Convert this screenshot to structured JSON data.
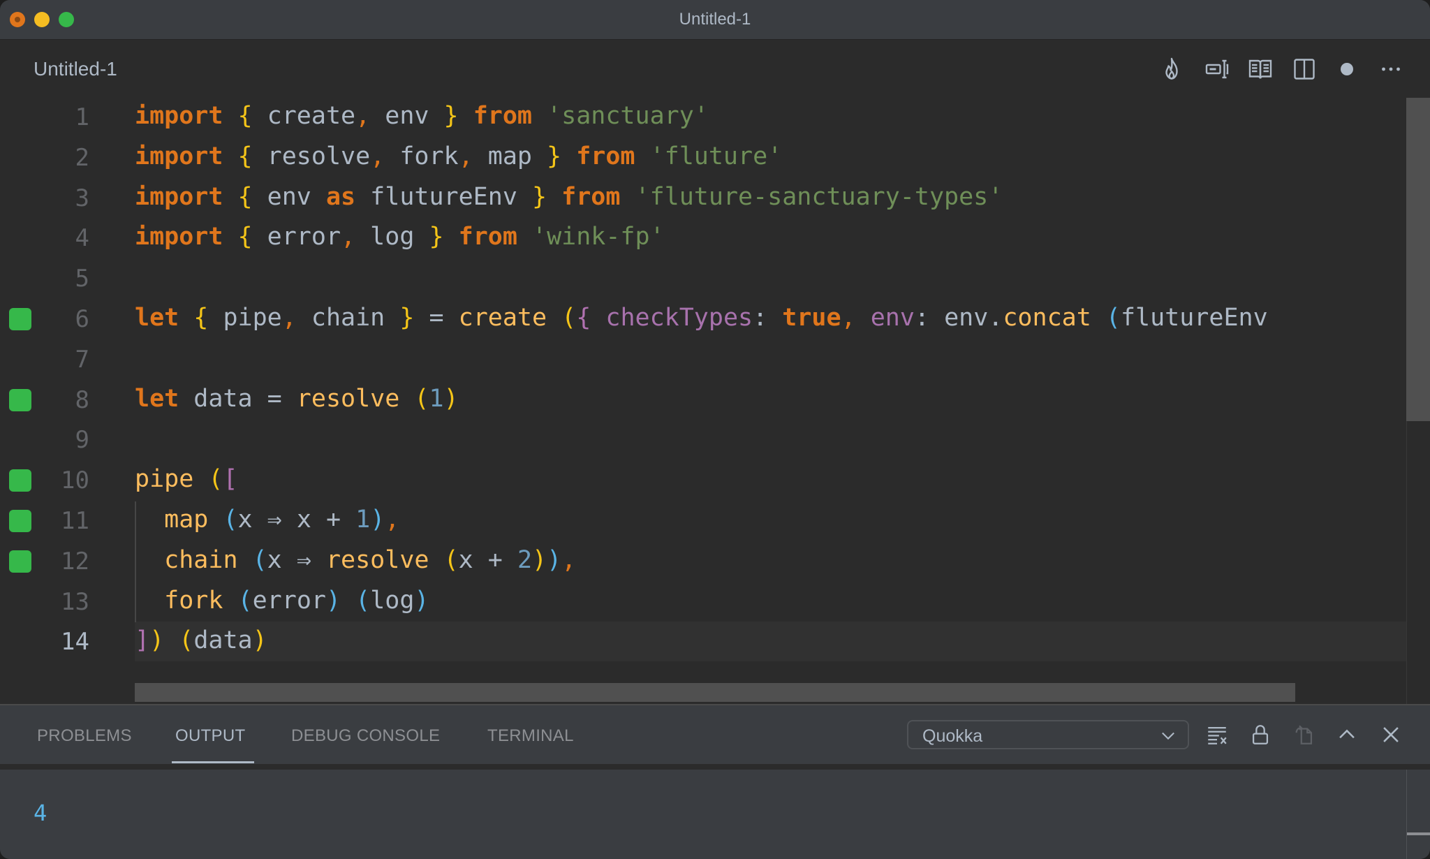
{
  "window": {
    "title": "Untitled-1",
    "traffic_lights": [
      "close",
      "minimize",
      "maximize"
    ]
  },
  "tab": {
    "label": "Untitled-1",
    "actions": [
      {
        "name": "quokka-flame-icon"
      },
      {
        "name": "rename-symbol-icon"
      },
      {
        "name": "open-preview-icon"
      },
      {
        "name": "split-editor-icon"
      },
      {
        "name": "unsaved-dot-icon"
      },
      {
        "name": "more-actions-icon"
      }
    ]
  },
  "editor": {
    "current_line": 14,
    "coverage_markers": [
      6,
      8,
      10,
      11,
      12
    ],
    "lines": [
      {
        "n": "1",
        "tokens": [
          [
            "kw",
            "import"
          ],
          [
            "plain",
            " "
          ],
          [
            "br-y",
            "{"
          ],
          [
            "plain",
            " create"
          ],
          [
            "punct",
            ","
          ],
          [
            "plain",
            " env "
          ],
          [
            "br-y",
            "}"
          ],
          [
            "plain",
            " "
          ],
          [
            "kw",
            "from"
          ],
          [
            "plain",
            " "
          ],
          [
            "str",
            "'sanctuary'"
          ]
        ]
      },
      {
        "n": "2",
        "tokens": [
          [
            "kw",
            "import"
          ],
          [
            "plain",
            " "
          ],
          [
            "br-y",
            "{"
          ],
          [
            "plain",
            " resolve"
          ],
          [
            "punct",
            ","
          ],
          [
            "plain",
            " fork"
          ],
          [
            "punct",
            ","
          ],
          [
            "plain",
            " map "
          ],
          [
            "br-y",
            "}"
          ],
          [
            "plain",
            " "
          ],
          [
            "kw",
            "from"
          ],
          [
            "plain",
            " "
          ],
          [
            "str",
            "'fluture'"
          ]
        ]
      },
      {
        "n": "3",
        "tokens": [
          [
            "kw",
            "import"
          ],
          [
            "plain",
            " "
          ],
          [
            "br-y",
            "{"
          ],
          [
            "plain",
            " env "
          ],
          [
            "kw",
            "as"
          ],
          [
            "plain",
            " flutureEnv "
          ],
          [
            "br-y",
            "}"
          ],
          [
            "plain",
            " "
          ],
          [
            "kw",
            "from"
          ],
          [
            "plain",
            " "
          ],
          [
            "str",
            "'fluture-sanctuary-types'"
          ]
        ]
      },
      {
        "n": "4",
        "tokens": [
          [
            "kw",
            "import"
          ],
          [
            "plain",
            " "
          ],
          [
            "br-y",
            "{"
          ],
          [
            "plain",
            " error"
          ],
          [
            "punct",
            ","
          ],
          [
            "plain",
            " log "
          ],
          [
            "br-y",
            "}"
          ],
          [
            "plain",
            " "
          ],
          [
            "kw",
            "from"
          ],
          [
            "plain",
            " "
          ],
          [
            "str",
            "'wink-fp'"
          ]
        ]
      },
      {
        "n": "5",
        "tokens": []
      },
      {
        "n": "6",
        "tokens": [
          [
            "kw",
            "let"
          ],
          [
            "plain",
            " "
          ],
          [
            "br-y",
            "{"
          ],
          [
            "plain",
            " pipe"
          ],
          [
            "punct",
            ","
          ],
          [
            "plain",
            " chain "
          ],
          [
            "br-y",
            "}"
          ],
          [
            "plain",
            " = "
          ],
          [
            "fn",
            "create"
          ],
          [
            "plain",
            " "
          ],
          [
            "br-y",
            "("
          ],
          [
            "br-p",
            "{"
          ],
          [
            "plain",
            " "
          ],
          [
            "prop",
            "checkTypes"
          ],
          [
            "plain",
            ": "
          ],
          [
            "kw",
            "true"
          ],
          [
            "punct",
            ","
          ],
          [
            "plain",
            " "
          ],
          [
            "prop",
            "env"
          ],
          [
            "plain",
            ": env."
          ],
          [
            "fn",
            "concat"
          ],
          [
            "plain",
            " "
          ],
          [
            "br-b",
            "("
          ],
          [
            "plain",
            "flutureEnv"
          ]
        ]
      },
      {
        "n": "7",
        "tokens": []
      },
      {
        "n": "8",
        "tokens": [
          [
            "kw",
            "let"
          ],
          [
            "plain",
            " data = "
          ],
          [
            "fn",
            "resolve"
          ],
          [
            "plain",
            " "
          ],
          [
            "br-y",
            "("
          ],
          [
            "num",
            "1"
          ],
          [
            "br-y",
            ")"
          ]
        ]
      },
      {
        "n": "9",
        "tokens": []
      },
      {
        "n": "10",
        "tokens": [
          [
            "fn",
            "pipe"
          ],
          [
            "plain",
            " "
          ],
          [
            "br-y",
            "("
          ],
          [
            "br-p",
            "["
          ]
        ]
      },
      {
        "n": "11",
        "tokens": [
          [
            "plain",
            "  "
          ],
          [
            "fn",
            "map"
          ],
          [
            "plain",
            " "
          ],
          [
            "br-b",
            "("
          ],
          [
            "plain",
            "x ⇒ x + "
          ],
          [
            "num",
            "1"
          ],
          [
            "br-b",
            ")"
          ],
          [
            "punct",
            ","
          ]
        ]
      },
      {
        "n": "12",
        "tokens": [
          [
            "plain",
            "  "
          ],
          [
            "fn",
            "chain"
          ],
          [
            "plain",
            " "
          ],
          [
            "br-b",
            "("
          ],
          [
            "plain",
            "x ⇒ "
          ],
          [
            "fn",
            "resolve"
          ],
          [
            "plain",
            " "
          ],
          [
            "br-y",
            "("
          ],
          [
            "plain",
            "x + "
          ],
          [
            "num",
            "2"
          ],
          [
            "br-y",
            ")"
          ],
          [
            "br-b",
            ")"
          ],
          [
            "punct",
            ","
          ]
        ]
      },
      {
        "n": "13",
        "tokens": [
          [
            "plain",
            "  "
          ],
          [
            "fn",
            "fork"
          ],
          [
            "plain",
            " "
          ],
          [
            "br-b",
            "("
          ],
          [
            "plain",
            "error"
          ],
          [
            "br-b",
            ")"
          ],
          [
            "plain",
            " "
          ],
          [
            "br-b",
            "("
          ],
          [
            "plain",
            "log"
          ],
          [
            "br-b",
            ")"
          ]
        ]
      },
      {
        "n": "14",
        "tokens": [
          [
            "br-p",
            "]"
          ],
          [
            "br-y",
            ")"
          ],
          [
            "plain",
            " "
          ],
          [
            "br-y",
            "("
          ],
          [
            "plain",
            "data"
          ],
          [
            "br-y",
            ")"
          ]
        ]
      }
    ]
  },
  "panel": {
    "tabs": [
      {
        "label": "PROBLEMS",
        "active": false
      },
      {
        "label": "OUTPUT",
        "active": true
      },
      {
        "label": "DEBUG CONSOLE",
        "active": false
      },
      {
        "label": "TERMINAL",
        "active": false
      }
    ],
    "output_channel": "Quokka",
    "actions": [
      {
        "name": "clear-output-icon"
      },
      {
        "name": "lock-scroll-icon"
      },
      {
        "name": "open-log-file-icon"
      },
      {
        "name": "maximize-panel-icon"
      },
      {
        "name": "close-panel-icon"
      }
    ],
    "output": "4"
  },
  "colors": {
    "keyword": "#e0761c",
    "string": "#6f8f58",
    "function": "#fdbd5e",
    "property": "#a872ad",
    "number": "#6d9cbe",
    "bracket_yellow": "#f5c518",
    "bracket_purple": "#b071b0",
    "bracket_blue": "#5ab4e6",
    "coverage_green": "#36b84a"
  }
}
